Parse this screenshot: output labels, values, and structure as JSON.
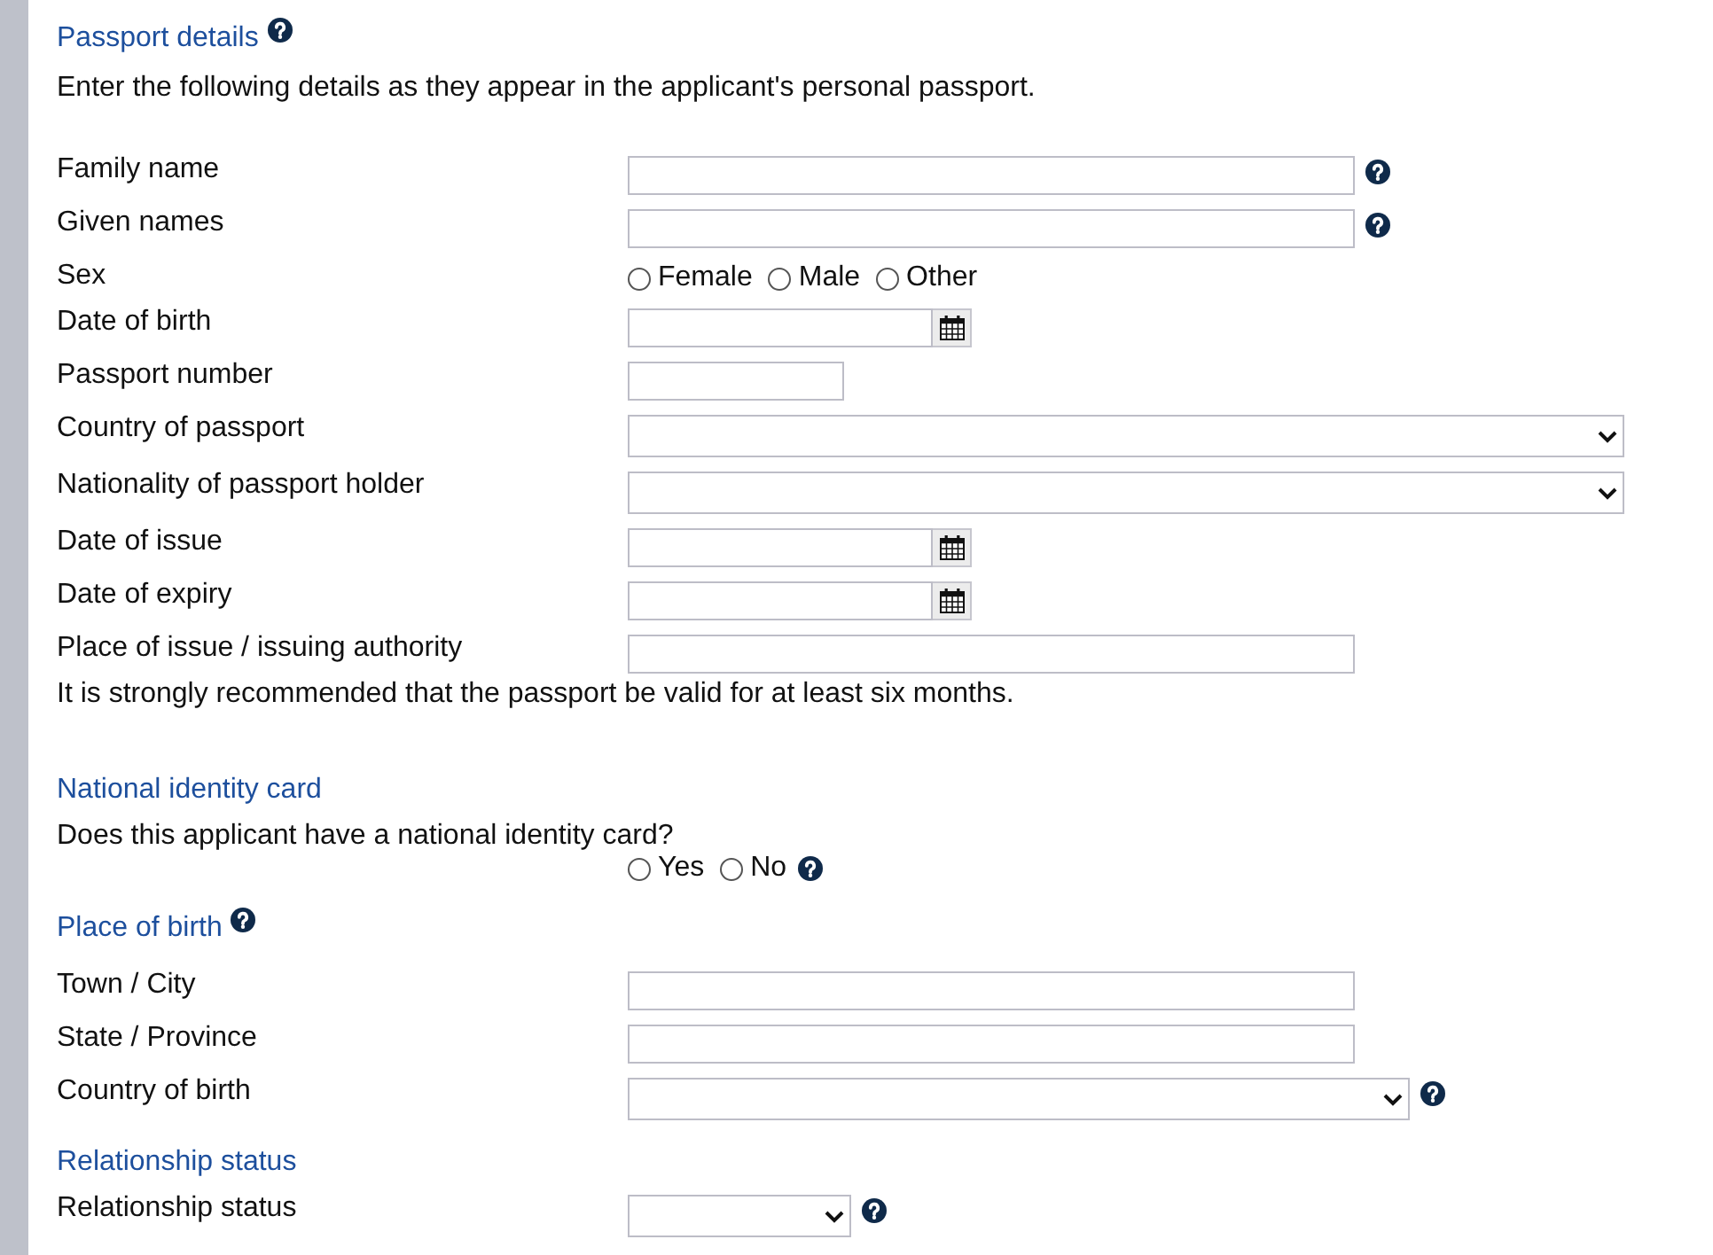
{
  "sections": [
    {
      "heading": "Passport details",
      "help": true,
      "blocks": [
        {
          "kind": "text",
          "text": "Enter the following details as they appear in the applicant's personal passport."
        },
        {
          "kind": "fields",
          "rows": [
            {
              "label": "Family name",
              "kind": "text",
              "help": true
            },
            {
              "label": "Given names",
              "kind": "text",
              "help": true
            },
            {
              "label": "Sex",
              "kind": "radios",
              "help": false,
              "options": [
                {
                  "label": "Female",
                  "selected": false
                },
                {
                  "label": "Male",
                  "selected": false
                },
                {
                  "label": "Other",
                  "selected": false
                }
              ]
            },
            {
              "label": "Date of birth",
              "kind": "date",
              "help": false
            },
            {
              "label": "Passport number",
              "kind": "short_text",
              "help": false
            },
            {
              "label": "Country of passport",
              "kind": "select",
              "help": false
            },
            {
              "label": "Nationality of passport holder",
              "kind": "select",
              "help": false
            },
            {
              "label": "Date of issue",
              "kind": "date",
              "help": false
            },
            {
              "label": "Date of expiry",
              "kind": "date",
              "help": false
            },
            {
              "label": "Place of issue / issuing authority",
              "kind": "text",
              "help": false
            }
          ]
        },
        {
          "kind": "note",
          "text": "It is strongly recommended that the passport be valid for at least six months."
        }
      ]
    },
    {
      "heading": "National identity card",
      "help": false,
      "blocks": [
        {
          "kind": "question",
          "text": "Does this applicant have a national identity card?"
        },
        {
          "kind": "choice",
          "help": true,
          "options": [
            {
              "label": "Yes",
              "selected": false
            },
            {
              "label": "No",
              "selected": false
            }
          ]
        }
      ]
    },
    {
      "heading": "Place of birth",
      "help": true,
      "blocks": [
        {
          "kind": "fields",
          "rows": [
            {
              "label": "Town / City",
              "kind": "text",
              "help": false
            },
            {
              "label": "State / Province",
              "kind": "text",
              "help": false
            },
            {
              "label": "Country of birth",
              "kind": "medium_select",
              "help": true
            }
          ]
        }
      ]
    },
    {
      "heading": "Relationship status",
      "help": false,
      "blocks": [
        {
          "kind": "fields",
          "rows": [
            {
              "label": "Relationship status",
              "kind": "short_select",
              "help": true
            }
          ]
        }
      ]
    }
  ]
}
